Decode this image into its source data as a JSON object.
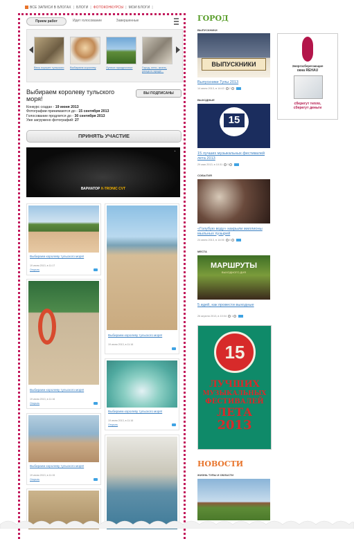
{
  "topnav": {
    "items": [
      "ВСЕ ЗАПИСИ В БЛОГАХ",
      "БЛОГИ",
      "ФОТОКОНКУРСЫ",
      "МОИ БЛОГИ"
    ]
  },
  "tabs": [
    "Прием работ",
    "Идет голосование",
    "Завершенные"
  ],
  "strip": {
    "captions": [
      "Весь портрет тульского",
      "Выбираем королеву",
      "Лунное праздничное",
      "Город, лето, жизнь, улица в городе..."
    ]
  },
  "contest": {
    "title": "Выбираем королеву тульского моря!",
    "subscribed": "ВЫ ПОДПИСАНЫ",
    "created_label": "Конкурс создан - ",
    "created": "19 июня 2013",
    "accept_label": "Фотографии принимаются до - ",
    "accept": "15 сентября 2013",
    "vote_label": "Голосование продлится до - ",
    "vote": "30 сентября 2013",
    "loaded_label": "Уже загружено фотографий: ",
    "loaded": "27",
    "join": "ПРИНЯТЬ УЧАСТИЕ"
  },
  "banner": {
    "text_white": "ВАРИАТОР ",
    "text_yellow": "X-TRONIC CVT"
  },
  "cards": {
    "title": "Выбираем королеву тульского моря!",
    "date1": "19 июня 2013, в 11:17",
    "date2": "19 июня 2013, в 11:16",
    "date3": "19 июня 2013, в 11:16",
    "date4": "19 июня 2013, в 11:16",
    "date5": "19 июня 2013, в 11:15",
    "open": "Открыть"
  },
  "right": {
    "city_head": "ГОРОД",
    "cat1": "ВЫПУСКНИКИ",
    "title1": "Выпускники Тулы 2013",
    "meta1": "14 июня 2013, в 14:43",
    "count1": "2",
    "cat2": "ВЫХОДНЫЕ",
    "title2": "15 лучших музыкальных фестивалей лета 2013",
    "meta2": "29 мая 2013, в 10:31",
    "count2": "5",
    "cat3": "СОБЫТИЯ",
    "title3": "«Голубую воду» накрыли миллионы мыльных пузырей",
    "meta3": "24 июня 2013, в 14:06",
    "count3": "8",
    "cat4": "МЕСТА",
    "title4": "5 идей, как провести выходные",
    "meta4": "26 апреля 2013, в 10:04",
    "count4": "1",
    "news_head": "НОВОСТИ",
    "news_cat": "ЖИЗНЬ ТУЛЫ И ОБЛАСТИ",
    "img1_text": "ВЫПУСКНИКИ",
    "img2_num": "15",
    "img4_text": "МАРШРУТЫ",
    "img4_sub": "ВЫХОДНОГО ДНЯ",
    "poster_num": "15",
    "poster_l1": "ЛУЧШИХ",
    "poster_l2": "МУЗЫКАЛЬНЫХ",
    "poster_l3": "ФЕСТИВАЛЕЙ",
    "poster_l4": "ЛЕТА",
    "poster_l5": "2013"
  },
  "ad": {
    "l1": "Энергосберегающие",
    "l2": "окна REHAU",
    "l3": "сберегут тепло,",
    "l4": "сберегут деньги"
  },
  "colors": {
    "accent_green": "#5a9e2c",
    "news_orange": "#e8742b",
    "border_pink": "#c2185b",
    "link_blue": "#3a7fc1"
  }
}
